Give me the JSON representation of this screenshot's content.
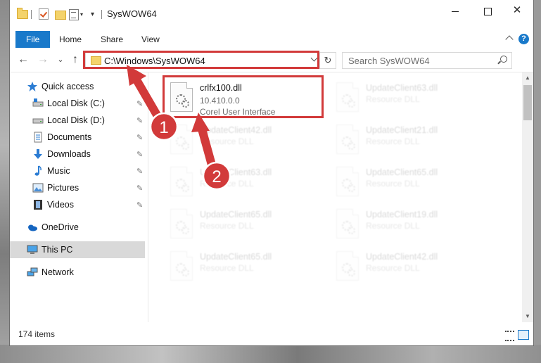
{
  "window": {
    "title": "SysWOW64",
    "qat_dropdown": "▾",
    "controls": {
      "minimize": "—",
      "maximize": "□",
      "close": "✕"
    }
  },
  "ribbon": {
    "tabs": [
      "File",
      "Home",
      "Share",
      "View"
    ],
    "help": "?"
  },
  "nav": {
    "back": "←",
    "forward": "→",
    "recent": "⌄",
    "up": "↑"
  },
  "address": {
    "path": "C:\\Windows\\SysWOW64",
    "refresh": "↻"
  },
  "search": {
    "placeholder": "Search SysWOW64"
  },
  "sidebar": {
    "items": [
      {
        "label": "Quick access",
        "icon": "star-icon",
        "pinned": false
      },
      {
        "label": "Local Disk (C:)",
        "icon": "drive-icon",
        "pinned": true
      },
      {
        "label": "Local Disk (D:)",
        "icon": "drive-icon",
        "pinned": true
      },
      {
        "label": "Documents",
        "icon": "documents-icon",
        "pinned": true
      },
      {
        "label": "Downloads",
        "icon": "downloads-icon",
        "pinned": true
      },
      {
        "label": "Music",
        "icon": "music-icon",
        "pinned": true
      },
      {
        "label": "Pictures",
        "icon": "pictures-icon",
        "pinned": true
      },
      {
        "label": "Videos",
        "icon": "videos-icon",
        "pinned": true
      },
      {
        "label": "OneDrive",
        "icon": "onedrive-icon",
        "pinned": false
      },
      {
        "label": "This PC",
        "icon": "this-pc-icon",
        "pinned": false,
        "selected": true
      },
      {
        "label": "Network",
        "icon": "network-icon",
        "pinned": false
      }
    ],
    "pin_glyph": "📌"
  },
  "files": [
    {
      "name": "crlfx100.dll",
      "line2": "10.410.0.0",
      "line3": "Corel User Interface",
      "highlighted": true
    },
    {
      "name": "UpdateClient63.dll",
      "line2": "Resource DLL"
    },
    {
      "name": "UpdateClient42.dll",
      "line2": "Resource DLL"
    },
    {
      "name": "UpdateClient21.dll",
      "line2": "Resource DLL"
    },
    {
      "name": "UpdateClient63.dll",
      "line2": "Resource DLL"
    },
    {
      "name": "UpdateClient65.dll",
      "line2": "Resource DLL"
    },
    {
      "name": "UpdateClient65.dll",
      "line2": "Resource DLL"
    },
    {
      "name": "UpdateClient19.dll",
      "line2": "Resource DLL"
    },
    {
      "name": "UpdateClient65.dll",
      "line2": "Resource DLL"
    },
    {
      "name": "UpdateClient42.dll",
      "line2": "Resource DLL"
    }
  ],
  "status": {
    "item_count": "174 items"
  },
  "annotations": {
    "step1": "1",
    "step2": "2",
    "color": "#d23a3a"
  },
  "colors": {
    "accent": "#1979ca",
    "highlight": "#d23a3a",
    "selected_nav": "#d9d9d9"
  }
}
